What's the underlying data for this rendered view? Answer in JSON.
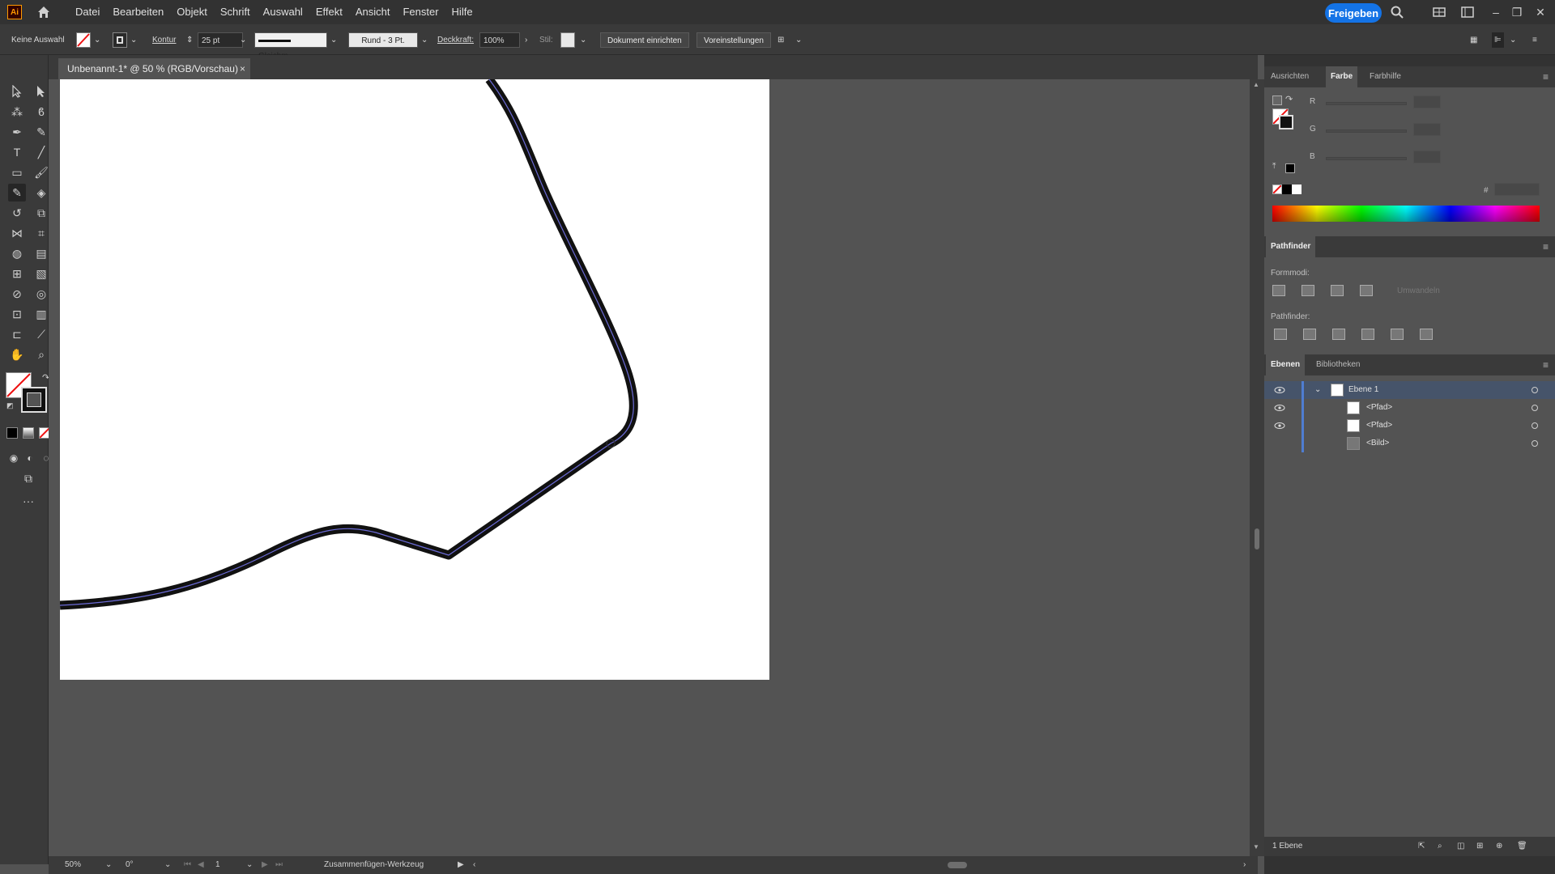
{
  "app": {
    "logo_text": "Ai",
    "share_label": "Freigeben",
    "menu": [
      "Datei",
      "Bearbeiten",
      "Objekt",
      "Schrift",
      "Auswahl",
      "Effekt",
      "Ansicht",
      "Fenster",
      "Hilfe"
    ]
  },
  "control_bar": {
    "selection_label": "Keine Auswahl",
    "stroke_label": "Kontur",
    "stroke_weight": "25 pt",
    "stroke_profile": "Gleichm.",
    "brush": "Rund - 3 Pt.",
    "opacity_label": "Deckkraft:",
    "opacity_value": "100%",
    "style_label": "Stil:",
    "doc_setup_button": "Dokument einrichten",
    "preferences_button": "Voreinstellungen"
  },
  "document": {
    "tab_title": "Unbenannt-1* @ 50 % (RGB/Vorschau)",
    "close": "×"
  },
  "status_bar": {
    "zoom": "50%",
    "rotation": "0°",
    "artboard_number": "1",
    "current_tool": "Zusammenfügen-Werkzeug"
  },
  "color_panel": {
    "tabs": [
      "Ausrichten",
      "Farbe",
      "Farbhilfe"
    ],
    "active_tab": "Farbe",
    "channels": [
      "R",
      "G",
      "B"
    ],
    "hex_label": "#"
  },
  "pathfinder_panel": {
    "title": "Pathfinder",
    "shape_modes_label": "Formmodi:",
    "expand_button": "Umwandeln",
    "pathfinders_label": "Pathfinder:"
  },
  "layers_panel": {
    "tabs": [
      "Ebenen",
      "Bibliotheken"
    ],
    "active_tab": "Ebenen",
    "layers": [
      {
        "name": "Ebene 1",
        "level": 0,
        "selected": true
      },
      {
        "name": "<Pfad>",
        "level": 1,
        "selected": false
      },
      {
        "name": "<Pfad>",
        "level": 1,
        "selected": false
      },
      {
        "name": "<Bild>",
        "level": 1,
        "selected": false
      }
    ],
    "footer_count": "1 Ebene"
  },
  "colors": {
    "accent": "#1473e6",
    "selection": "#46546a",
    "path_stroke": "#111111",
    "path_highlight": "#6b6bd6"
  }
}
